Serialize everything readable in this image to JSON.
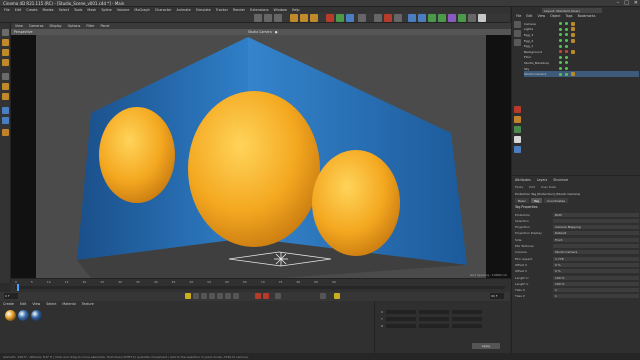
{
  "window": {
    "title": "Cinema 4D R21.115 (RC) - [Studio_Scene_v001.c4d *] - Main",
    "controls": [
      "–",
      "□",
      "✕"
    ]
  },
  "menubar": [
    "File",
    "Edit",
    "Create",
    "Modes",
    "Select",
    "Tools",
    "Mesh",
    "Spline",
    "Volume",
    "MoGraph",
    "Character",
    "Animate",
    "Simulate",
    "Tracker",
    "Render",
    "Extensions",
    "Window",
    "Help"
  ],
  "toolbar_icons": [
    "undo-icon",
    "redo-icon",
    "select-icon",
    "move-icon",
    "scale-icon",
    "rotate-icon",
    "axis-x-icon",
    "axis-y-icon",
    "axis-z-icon",
    "coordinate-icon",
    "render-region-icon",
    "render-view-icon",
    "render-settings-icon",
    "cube-icon",
    "pen-icon",
    "subdivision-icon",
    "cloner-icon",
    "deformer-icon",
    "floor-icon",
    "camera-icon",
    "light-icon"
  ],
  "viewport": {
    "menu": [
      "View",
      "Cameras",
      "Display",
      "Options",
      "Filter",
      "Panel"
    ],
    "title": "Perspective",
    "camera": "Studio Camera · ●",
    "status": "Grid Spacing : 10000 cm"
  },
  "timeline": {
    "ticks": [
      "0",
      "5",
      "10",
      "15",
      "20",
      "25",
      "30",
      "35",
      "40",
      "45",
      "50",
      "55",
      "60",
      "65",
      "70",
      "75",
      "80",
      "85",
      "90"
    ],
    "current_frame": "0 F",
    "end_frame": "90 F"
  },
  "material_panel": {
    "menu": [
      "Create",
      "Edit",
      "View",
      "Select",
      "Material",
      "Texture"
    ],
    "materials": [
      {
        "name": "Egg",
        "color": "#e8a22a"
      },
      {
        "name": "Mat.1",
        "color": "#3a6fb0"
      },
      {
        "name": "Mat.2",
        "color": "#2e5f9e"
      }
    ]
  },
  "coordinates": {
    "rows": [
      {
        "axis": "X",
        "pos": "0 cm",
        "size": "0 cm",
        "rot": "0°"
      },
      {
        "axis": "Y",
        "pos": "0 cm",
        "size": "0 cm",
        "rot": "0°"
      },
      {
        "axis": "Z",
        "pos": "0 cm",
        "size": "0 cm",
        "rot": "0°"
      }
    ],
    "apply_label": "Apply"
  },
  "statusbar": "Azimuth: 158.5°, Altitude: 8.6° E | Click and drag to move elements. Hold down SHIFT to quantize movement / add to the selection in point mode, CTRL to remove.",
  "right_panel": {
    "layout": "Layout: Standard (User)",
    "menu": [
      "File",
      "Edit",
      "View",
      "Object",
      "Tags",
      "Bookmarks"
    ],
    "objects": [
      {
        "name": "Camera",
        "dot": "#5fbf5f",
        "tag": true
      },
      {
        "name": "Lights",
        "dot": "#5fbf5f",
        "tag": true
      },
      {
        "name": "Egg_3",
        "dot": "#5fbf5f",
        "tag": true
      },
      {
        "name": "Egg_2",
        "dot": "#5fbf5f",
        "tag": true
      },
      {
        "name": "Egg_1",
        "dot": "#5fbf5f",
        "tag": false
      },
      {
        "name": "Background",
        "dot": "#c94a3a",
        "tag": true
      },
      {
        "name": "Floor",
        "dot": "#5fbf5f",
        "tag": false
      },
      {
        "name": "Studio_Backdrop",
        "dot": "#5fbf5f",
        "tag": false
      },
      {
        "name": "Sky",
        "dot": "#5fbf5f",
        "tag": false
      },
      {
        "name": "Studio Camera",
        "dot": "#5fbf5f",
        "tag": true
      }
    ],
    "selected_index": 9
  },
  "attributes": {
    "tabs": [
      "Attributes",
      "Layers",
      "Structure"
    ],
    "menu": [
      "Mode",
      "Edit",
      "User Data"
    ],
    "object": "Protection Tag [Protection] (Studio Camera)",
    "subtabs": [
      "Basic",
      "Tag",
      "Coordinates"
    ],
    "active_subtab": 1,
    "heading": "Tag Properties",
    "props": [
      {
        "label": "Protection",
        "value": "Both"
      },
      {
        "label": "Selection",
        "value": ""
      },
      {
        "label": "Projection",
        "value": "Camera Mapping"
      },
      {
        "label": "Projection Display",
        "value": "Default"
      },
      {
        "label": "Side",
        "value": "Front"
      },
      {
        "label": "Mix Textures",
        "value": ""
      },
      {
        "label": "Camera",
        "value": "Studio Camera"
      },
      {
        "label": "Film Aspect",
        "value": "1.778"
      },
      {
        "label": "Offset U",
        "value": "0 %"
      },
      {
        "label": "Offset V",
        "value": "0 %"
      },
      {
        "label": "Length U",
        "value": "100 %"
      },
      {
        "label": "Length V",
        "value": "100 %"
      },
      {
        "label": "Tiles U",
        "value": "1"
      },
      {
        "label": "Tiles V",
        "value": "1"
      }
    ]
  }
}
